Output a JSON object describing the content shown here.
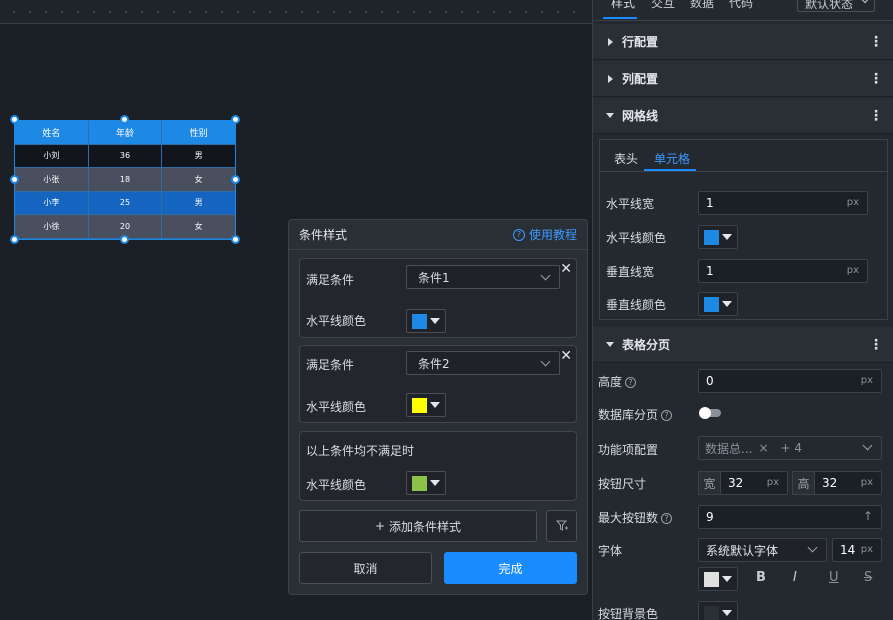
{
  "canvas": {
    "table": {
      "headers": [
        "姓名",
        "年龄",
        "性别"
      ],
      "rows": [
        [
          "小刘",
          "36",
          "男"
        ],
        [
          "小张",
          "18",
          "女"
        ],
        [
          "小李",
          "25",
          "男"
        ],
        [
          "小徐",
          "20",
          "女"
        ]
      ]
    }
  },
  "dialog": {
    "title": "条件样式",
    "help_icon": "?",
    "help_label": "使用教程",
    "conditions": [
      {
        "label": "满足条件",
        "value": "条件1",
        "color_label": "水平线颜色",
        "color": "#1e88e5"
      },
      {
        "label": "满足条件",
        "value": "条件2",
        "color_label": "水平线颜色",
        "color": "#ffff00"
      }
    ],
    "else_block": {
      "label": "以上条件均不满足时",
      "color_label": "水平线颜色",
      "color": "#8bc34a"
    },
    "close_glyph": "✕",
    "add_icon": "+",
    "add_label": "添加条件样式",
    "cancel_label": "取消",
    "done_label": "完成"
  },
  "panel": {
    "tabs": [
      "样式",
      "交互",
      "数据",
      "代码"
    ],
    "state_select": "默认状态",
    "sections": {
      "row_config": "行配置",
      "col_config": "列配置",
      "grid_lines": "网格线",
      "pagination": "表格分页"
    },
    "kebab": "⋮",
    "grid_tabs": [
      "表头",
      "单元格"
    ],
    "grid_fields": {
      "h_width_label": "水平线宽",
      "h_width_value": "1",
      "h_color_label": "水平线颜色",
      "h_color": "#1e88e5",
      "v_width_label": "垂直线宽",
      "v_width_value": "1",
      "v_color_label": "垂直线颜色",
      "v_color": "#1e88e5",
      "unit": "px"
    },
    "pagination_fields": {
      "height_label": "高度",
      "height_value": "0",
      "db_paging_label": "数据库分页",
      "feature_label": "功能项配置",
      "feature_tag": "数据总...",
      "feature_tag_remove": "×",
      "feature_more": "+ 4",
      "btn_size_label": "按钮尺寸",
      "width_prefix": "宽",
      "width_value": "32",
      "height_prefix": "高",
      "height_value2": "32",
      "max_btn_label": "最大按钮数",
      "max_btn_value": "9",
      "font_label": "字体",
      "font_value": "系统默认字体",
      "font_size": "14",
      "font_color": "#e0e0e0",
      "bold": "B",
      "italic": "I",
      "underline": "U",
      "strike": "S",
      "btn_bg_label": "按钮背景色",
      "btn_bg_color": "#2a2e35",
      "up_icon": "↑"
    }
  }
}
